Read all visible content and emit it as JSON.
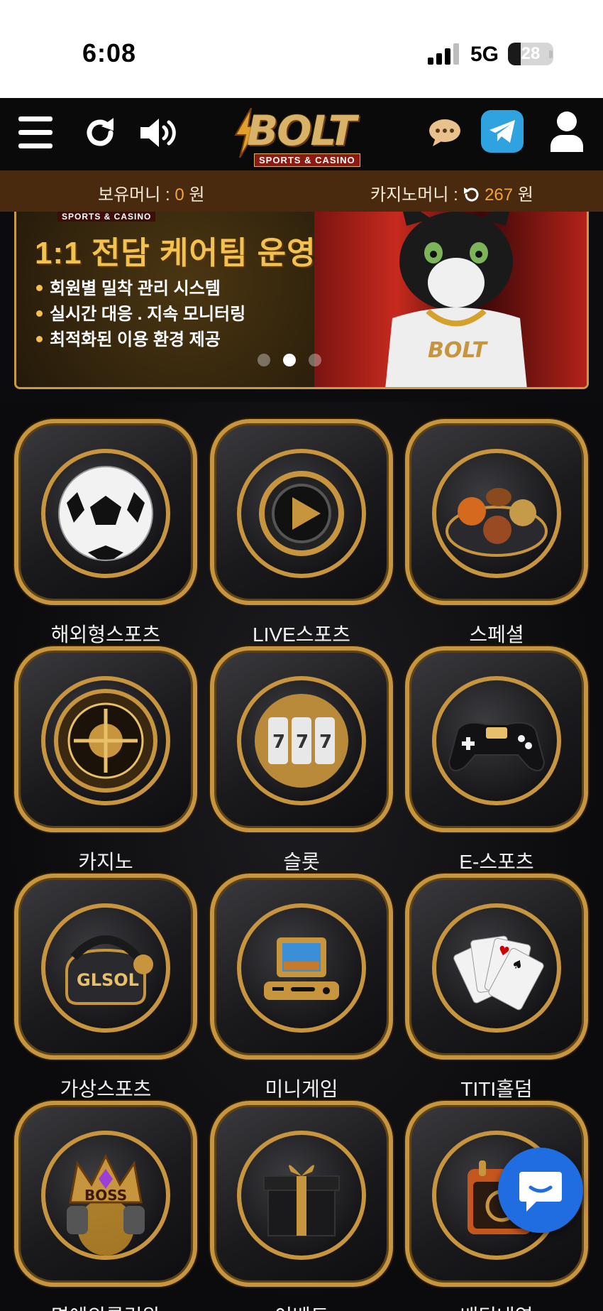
{
  "status_bar": {
    "time": "6:08",
    "network": "5G",
    "battery": "28",
    "battery_level": 0.28
  },
  "header": {
    "logo_text": "BOLT",
    "logo_sub": "SPORTS & CASINO",
    "colors": {
      "gold": "#d9b26a",
      "telegram": "#2ea3e0"
    }
  },
  "money": {
    "holding_label": "보유머니 : ",
    "holding_value": "0",
    "holding_unit": " 원",
    "casino_label": "카지노머니 : ",
    "casino_value": "267",
    "casino_unit": " 원"
  },
  "banner": {
    "small_tag": "SPORTS & CASINO",
    "title": "1:1 전담 케어팀 운영",
    "lines": [
      "회원별 밀착 관리 시스템",
      "실시간 대응 . 지속 모니터링",
      "최적화된 이용 환경 제공"
    ],
    "active_slide": 2,
    "slide_count": 3
  },
  "menu": [
    {
      "label": "해외형스포츠",
      "icon": "soccer-ball-icon"
    },
    {
      "label": "LIVE스포츠",
      "icon": "play-icon"
    },
    {
      "label": "스페셜",
      "icon": "sports-balls-icon"
    },
    {
      "label": "카지노",
      "icon": "roulette-icon"
    },
    {
      "label": "슬롯",
      "icon": "slot-reels-icon"
    },
    {
      "label": "E-스포츠",
      "icon": "gamepad-icon"
    },
    {
      "label": "가상스포츠",
      "icon": "vr-headset-icon"
    },
    {
      "label": "미니게임",
      "icon": "retro-console-icon"
    },
    {
      "label": "TITI홀덤",
      "icon": "playing-cards-icon"
    },
    {
      "label": "명예의롤링왕",
      "icon": "boss-crown-icon"
    },
    {
      "label": "이벤트",
      "icon": "gift-box-icon"
    },
    {
      "label": "배팅내역",
      "icon": "calendar-icon"
    }
  ],
  "vr_text": "GLSOL",
  "boss_text": "BOSS"
}
